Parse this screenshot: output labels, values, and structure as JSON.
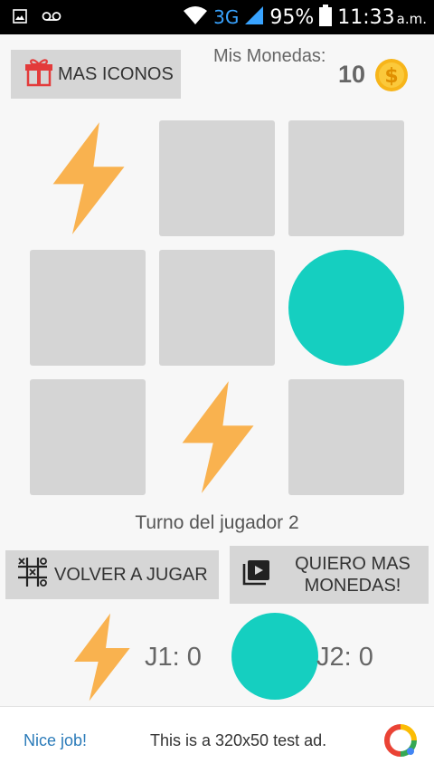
{
  "status_bar": {
    "network": "3G",
    "battery": "95%",
    "time": "11:33",
    "ampm": "a.m."
  },
  "header": {
    "more_icons_label": "MAS ICONOS",
    "coins_label": "Mis Monedas:",
    "coins_value": "10"
  },
  "board": {
    "cells": [
      "bolt",
      "empty",
      "empty",
      "empty",
      "empty",
      "circle",
      "empty",
      "bolt",
      "empty"
    ]
  },
  "turn_text": "Turno del jugador 2",
  "actions": {
    "replay_label": "VOLVER A JUGAR",
    "more_coins_label": "QUIERO MAS\nMONEDAS!"
  },
  "scores": {
    "p1_label": "J1: 0",
    "p2_label": "J2: 0"
  },
  "ad": {
    "cta": "Nice job!",
    "text": "This is a 320x50 test ad."
  },
  "colors": {
    "bolt": "#f9b24f",
    "circle": "#15cfc0",
    "cell_empty": "#d5d5d5",
    "button_bg": "#d6d6d6"
  },
  "icons": {
    "more_icons": "gift-icon",
    "coin": "coin-icon",
    "replay": "tic-tac-toe-icon",
    "more_coins": "video-play-icon"
  }
}
